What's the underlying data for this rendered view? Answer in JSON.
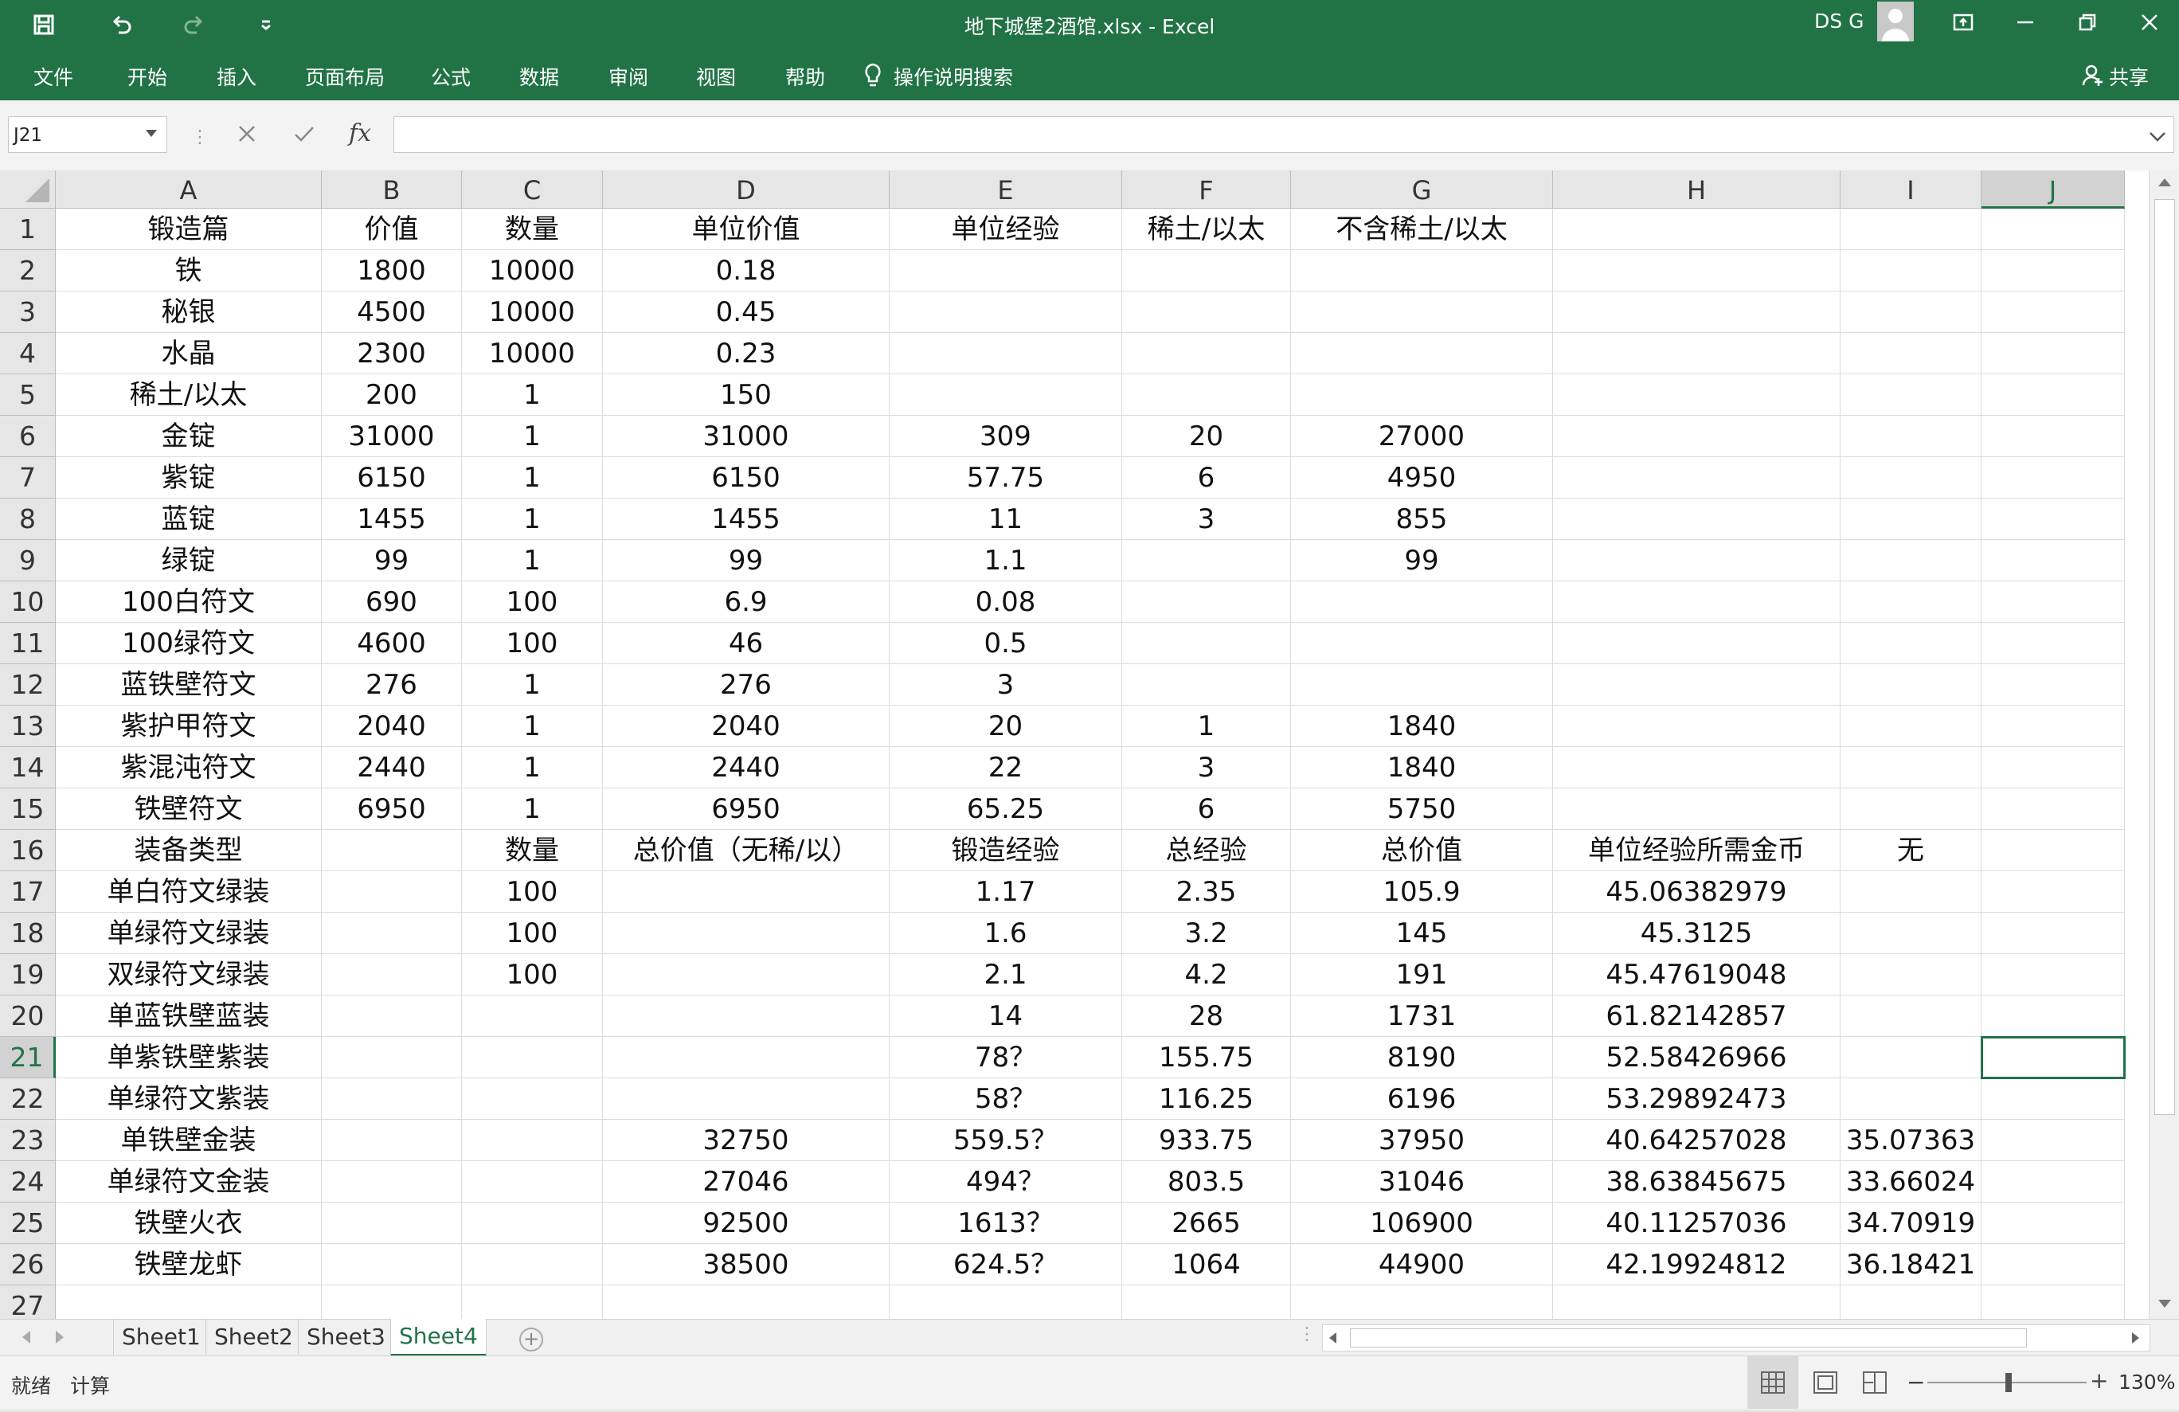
{
  "titlebar": {
    "title": "地下城堡2酒馆.xlsx  -  Excel",
    "user": "DS G"
  },
  "menu": [
    "文件",
    "开始",
    "插入",
    "页面布局",
    "公式",
    "数据",
    "审阅",
    "视图",
    "帮助"
  ],
  "search_label": "操作说明搜索",
  "share_label": "共享",
  "namebox": "J21",
  "fx_label": "fx",
  "columns": [
    "A",
    "B",
    "C",
    "D",
    "E",
    "F",
    "G",
    "H",
    "I",
    "J"
  ],
  "rows": [
    [
      "锻造篇",
      "价值",
      "数量",
      "单位价值",
      "单位经验",
      "稀土/以太",
      "不含稀土/以太",
      "",
      "",
      ""
    ],
    [
      "铁",
      "1800",
      "10000",
      "0.18",
      "",
      "",
      "",
      "",
      "",
      ""
    ],
    [
      "秘银",
      "4500",
      "10000",
      "0.45",
      "",
      "",
      "",
      "",
      "",
      ""
    ],
    [
      "水晶",
      "2300",
      "10000",
      "0.23",
      "",
      "",
      "",
      "",
      "",
      ""
    ],
    [
      "稀土/以太",
      "200",
      "1",
      "150",
      "",
      "",
      "",
      "",
      "",
      ""
    ],
    [
      "金锭",
      "31000",
      "1",
      "31000",
      "309",
      "20",
      "27000",
      "",
      "",
      ""
    ],
    [
      "紫锭",
      "6150",
      "1",
      "6150",
      "57.75",
      "6",
      "4950",
      "",
      "",
      ""
    ],
    [
      "蓝锭",
      "1455",
      "1",
      "1455",
      "11",
      "3",
      "855",
      "",
      "",
      ""
    ],
    [
      "绿锭",
      "99",
      "1",
      "99",
      "1.1",
      "",
      "99",
      "",
      "",
      ""
    ],
    [
      "100白符文",
      "690",
      "100",
      "6.9",
      "0.08",
      "",
      "",
      "",
      "",
      ""
    ],
    [
      "100绿符文",
      "4600",
      "100",
      "46",
      "0.5",
      "",
      "",
      "",
      "",
      ""
    ],
    [
      "蓝铁壁符文",
      "276",
      "1",
      "276",
      "3",
      "",
      "",
      "",
      "",
      ""
    ],
    [
      "紫护甲符文",
      "2040",
      "1",
      "2040",
      "20",
      "1",
      "1840",
      "",
      "",
      ""
    ],
    [
      "紫混沌符文",
      "2440",
      "1",
      "2440",
      "22",
      "3",
      "1840",
      "",
      "",
      ""
    ],
    [
      "铁壁符文",
      "6950",
      "1",
      "6950",
      "65.25",
      "6",
      "5750",
      "",
      "",
      ""
    ],
    [
      "装备类型",
      "",
      "数量",
      "总价值（无稀/以）",
      "锻造经验",
      "总经验",
      "总价值",
      "单位经验所需金币",
      "无",
      ""
    ],
    [
      "单白符文绿装",
      "",
      "100",
      "",
      "1.17",
      "2.35",
      "105.9",
      "45.06382979",
      "",
      ""
    ],
    [
      "单绿符文绿装",
      "",
      "100",
      "",
      "1.6",
      "3.2",
      "145",
      "45.3125",
      "",
      ""
    ],
    [
      "双绿符文绿装",
      "",
      "100",
      "",
      "2.1",
      "4.2",
      "191",
      "45.47619048",
      "",
      ""
    ],
    [
      "单蓝铁壁蓝装",
      "",
      "",
      "",
      "14",
      "28",
      "1731",
      "61.82142857",
      "",
      ""
    ],
    [
      "单紫铁壁紫装",
      "",
      "",
      "",
      "78？",
      "155.75",
      "8190",
      "52.58426966",
      "",
      ""
    ],
    [
      "单绿符文紫装",
      "",
      "",
      "",
      "58？",
      "116.25",
      "6196",
      "53.29892473",
      "",
      ""
    ],
    [
      "单铁壁金装",
      "",
      "",
      "32750",
      "559.5？",
      "933.75",
      "37950",
      "40.64257028",
      "35.07363",
      ""
    ],
    [
      "单绿符文金装",
      "",
      "",
      "27046",
      "494？",
      "803.5",
      "31046",
      "38.63845675",
      "33.66024",
      ""
    ],
    [
      "铁壁火衣",
      "",
      "",
      "92500",
      "1613？",
      "2665",
      "106900",
      "40.11257036",
      "34.70919",
      ""
    ],
    [
      "铁壁龙虾",
      "",
      "",
      "38500",
      "624.5？",
      "1064",
      "44900",
      "42.19924812",
      "36.18421",
      ""
    ],
    [
      "",
      "",
      "",
      "",
      "",
      "",
      "",
      "",
      "",
      ""
    ]
  ],
  "sheets": [
    "Sheet1",
    "Sheet2",
    "Sheet3",
    "Sheet4"
  ],
  "active_sheet": "Sheet4",
  "active_cell": {
    "row": 21,
    "col": "J"
  },
  "status": {
    "ready": "就绪",
    "calc": "计算",
    "zoom": "130%"
  },
  "colors": {
    "excel_green": "#217346",
    "active_tab": "#217346"
  }
}
